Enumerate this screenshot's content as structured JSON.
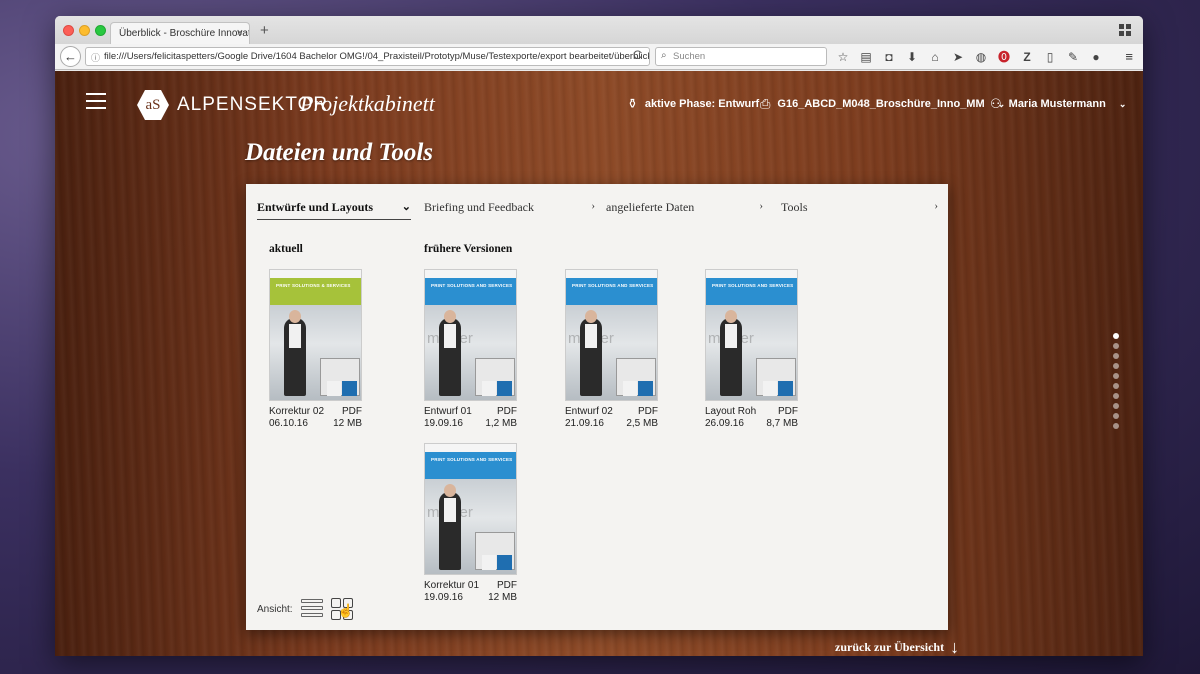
{
  "browser": {
    "tab_title": "Überblick - Broschüre Innovatio...",
    "tab_close": "×",
    "new_tab": "+",
    "back": "←",
    "url": "file:///Users/felicitaspetters/Google Drive/1604 Bachelor OMG!/04_Praxisteil/Prototyp/Muse/Testexporte/export bearbeitet/überblick",
    "reload": "C",
    "search_placeholder": "Suchen",
    "toolbar_icons": [
      "star-icon",
      "reading-list-icon",
      "pocket-icon",
      "download-icon",
      "home-icon",
      "send-icon",
      "globe-icon",
      "pinterest-icon",
      "zotero-icon",
      "page-icon",
      "eyedropper-icon",
      "dark-circle-icon"
    ],
    "menu": "≡"
  },
  "site": {
    "logo_mark": "aS",
    "logo_text": "ALPENSEKTOR",
    "app_name": "Projektkabinett",
    "phase": "aktive Phase: Entwurf",
    "project": "G16_ABCD_M048_Broschüre_Inno_MM",
    "user": "Maria Mustermann"
  },
  "page": {
    "title": "Dateien und Tools",
    "back_link": "zurück zur Übersicht"
  },
  "tabs": [
    {
      "label": "Entwürfe und Layouts",
      "chevron": "⌄",
      "active": true
    },
    {
      "label": "Briefing und Feedback",
      "chevron": "›"
    },
    {
      "label": "angelieferte Daten",
      "chevron": "›"
    },
    {
      "label": "Tools",
      "chevron": "›"
    }
  ],
  "sections": {
    "current": "aktuell",
    "previous": "frühere Versionen"
  },
  "documents": [
    {
      "name": "Korrektur 02",
      "date": "06.10.16",
      "type": "PDF",
      "size": "12 MB",
      "band_title": "PRINT SOLUTIONS & SERVICES",
      "band_color": "#a6c23a"
    },
    {
      "name": "Entwurf 01",
      "date": "19.09.16",
      "type": "PDF",
      "size": "1,2 MB",
      "band_title": "PRINT SOLUTIONS AND SERVICES",
      "band_color": "#2b8fd0"
    },
    {
      "name": "Entwurf 02",
      "date": "21.09.16",
      "type": "PDF",
      "size": "2,5 MB",
      "band_title": "PRINT SOLUTIONS AND SERVICES",
      "band_color": "#2b8fd0"
    },
    {
      "name": "Layout Roh",
      "date": "26.09.16",
      "type": "PDF",
      "size": "8,7 MB",
      "band_title": "PRINT SOLUTIONS AND SERVICES",
      "band_color": "#2b8fd0"
    },
    {
      "name": "Korrektur 01",
      "date": "19.09.16",
      "type": "PDF",
      "size": "12 MB",
      "band_title": "PRINT SOLUTIONS AND SERVICES",
      "band_color": "#2b8fd0"
    }
  ],
  "view": {
    "label": "Ansicht:"
  }
}
